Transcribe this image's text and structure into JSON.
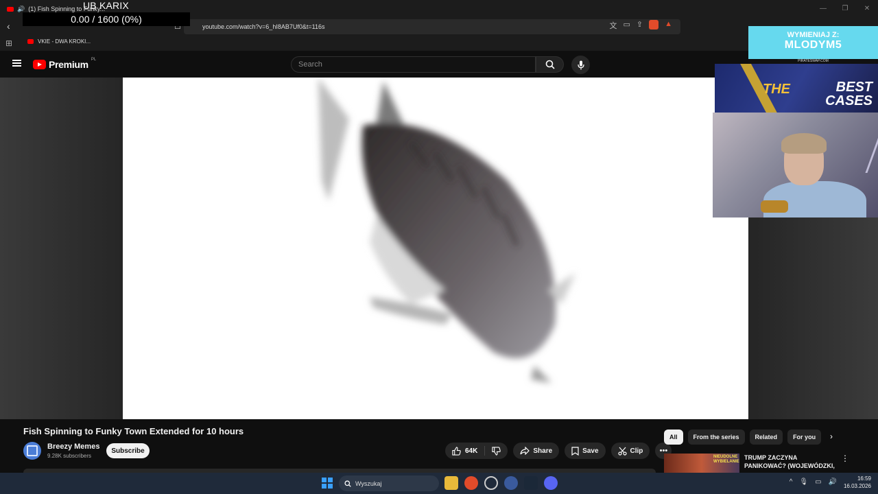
{
  "browser": {
    "tab_title": "(1) Fish Spinning to Funky...",
    "url": "youtube.com/watch?v=6_hI8AB7Uf0&t=116s",
    "bookmark": "VKIE - DWA KROKI..."
  },
  "overlay": {
    "title": "UB KARIX",
    "counter": "0.00 / 1600 (0%)",
    "promo_line1": "WYMIENIAJ Z:",
    "promo_line2": "MLODYM5",
    "promo_line3": "PIRATESWAP.COM",
    "cases_left": "THE",
    "cases_right_1": "BEST",
    "cases_right_2": "CASES"
  },
  "youtube": {
    "logo_text": "Premium",
    "logo_region": "PL",
    "search_placeholder": "Search"
  },
  "video": {
    "title": "Fish Spinning to Funky Town Extended for 10 hours",
    "channel": "Breezy Memes",
    "subscribers": "9.28K subscribers",
    "subscribe_label": "Subscribe",
    "likes": "64K",
    "share_label": "Share",
    "save_label": "Save",
    "clip_label": "Clip"
  },
  "sidebar": {
    "chips": [
      "All",
      "From the series",
      "Related",
      "For you"
    ],
    "rec_title": "TRUMP ZACZYNA PANIKOWAĆ? (WOJEWÓDZKI, ...",
    "rec_thumb_text": "NIEUDOLNE WYBIELANIE"
  },
  "taskbar": {
    "search_label": "Wyszukaj",
    "time": "16:59",
    "date": "16.03.2026"
  }
}
